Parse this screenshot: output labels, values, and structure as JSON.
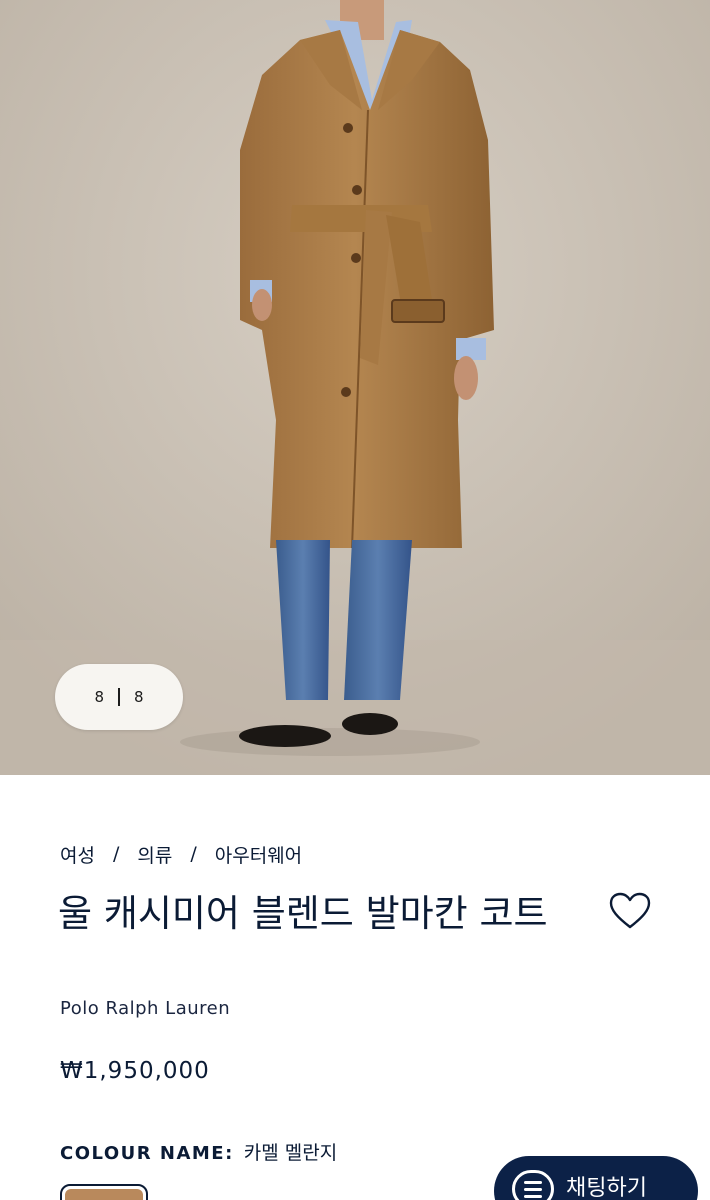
{
  "gallery": {
    "current": "8",
    "total": "8",
    "image_alt": "camel-coat-model-photo"
  },
  "breadcrumb": {
    "items": [
      "여성",
      "의류",
      "아우터웨어"
    ],
    "separator": "/"
  },
  "product": {
    "title": "울 캐시미어 블렌드 발마칸 코트",
    "brand": "Polo Ralph Lauren",
    "price": "₩1,950,000",
    "favorite_icon": "heart-outline-icon"
  },
  "colour": {
    "label": "COLOUR NAME:",
    "value": "카멜 멜란지",
    "swatch_color": "#b9895c"
  },
  "chat": {
    "label": "채팅하기",
    "icon": "chat-bubble-icon",
    "bg_color": "#0c2147"
  }
}
